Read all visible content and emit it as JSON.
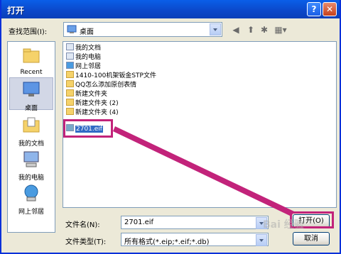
{
  "dialog": {
    "title": "打开",
    "help_glyph": "?",
    "close_glyph": "✕"
  },
  "lookin": {
    "label": "查找范围(I):",
    "value": "桌面"
  },
  "places": [
    {
      "label": "Recent"
    },
    {
      "label": "桌面"
    },
    {
      "label": "我的文档"
    },
    {
      "label": "我的电脑"
    },
    {
      "label": "网上邻居"
    }
  ],
  "files": [
    {
      "name": "我的文档",
      "icon": "doc-icon"
    },
    {
      "name": "我的电脑",
      "icon": "computer-icon"
    },
    {
      "name": "网上邻居",
      "icon": "network-icon"
    },
    {
      "name": "1410-100机架钣金STP文件",
      "icon": "folder-icon"
    },
    {
      "name": "QQ怎么添加原创表情",
      "icon": "folder-icon"
    },
    {
      "name": "新建文件夹",
      "icon": "folder-icon"
    },
    {
      "name": "新建文件夹 (2)",
      "icon": "folder-icon"
    },
    {
      "name": "新建文件夹 (4)",
      "icon": "folder-icon"
    },
    {
      "name": "2701.eif",
      "icon": "eif-file-icon"
    }
  ],
  "filename": {
    "label": "文件名(N):",
    "value": "2701.eif"
  },
  "filetype": {
    "label": "文件类型(T):",
    "value": "所有格式(*.eip;*.eif;*.db)"
  },
  "buttons": {
    "open": "打开(O)",
    "cancel": "取消"
  },
  "watermark": "Bai 经验",
  "colors": {
    "titlebar": "#0B47C9",
    "highlight": "#C2237A",
    "selection": "#316AC5"
  }
}
